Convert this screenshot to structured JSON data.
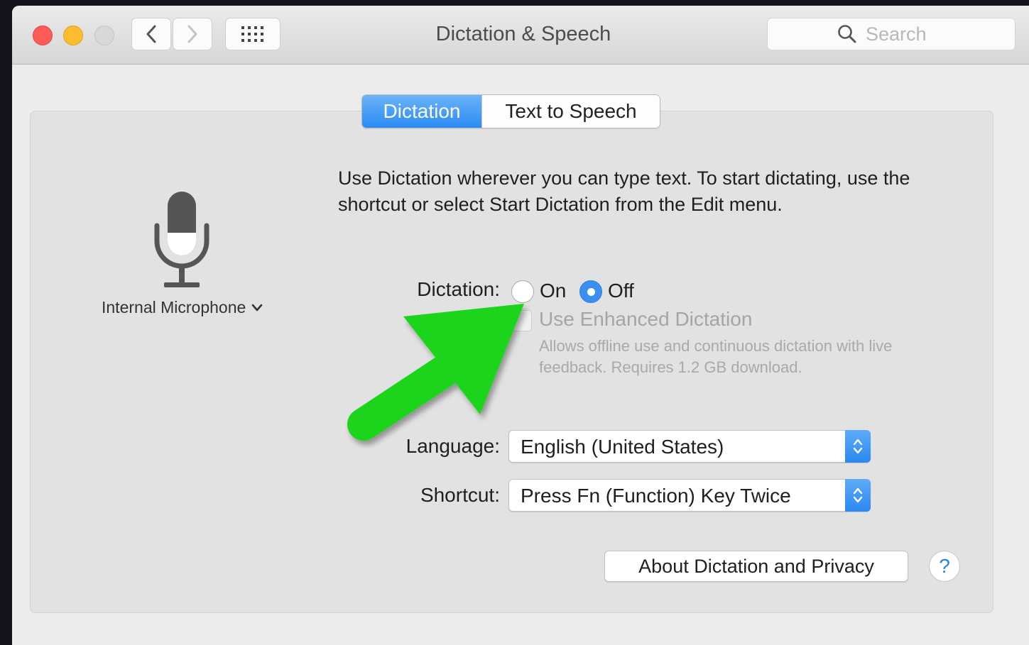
{
  "window": {
    "title": "Dictation & Speech"
  },
  "search": {
    "placeholder": "Search"
  },
  "tabs": [
    {
      "label": "Dictation",
      "selected": true
    },
    {
      "label": "Text to Speech",
      "selected": false
    }
  ],
  "microphone": {
    "label": "Internal Microphone"
  },
  "description": "Use Dictation wherever you can type text. To start dictating, use the shortcut or select Start Dictation from the Edit menu.",
  "dictation": {
    "label": "Dictation:",
    "on_label": "On",
    "off_label": "Off",
    "selected": "Off"
  },
  "enhanced": {
    "label": "Use Enhanced Dictation",
    "checked": false,
    "enabled": false,
    "description": "Allows offline use and continuous dictation with live feedback. Requires 1.2 GB download."
  },
  "language": {
    "label": "Language:",
    "value": "English (United States)"
  },
  "shortcut": {
    "label": "Shortcut:",
    "value": "Press Fn (Function) Key Twice"
  },
  "about_button": "About Dictation and Privacy",
  "help_button": "?",
  "colors": {
    "accent": "#2a8bf2",
    "annotation_arrow": "#1fd41f",
    "close": "#fc5b57",
    "minimize": "#fdbb2e"
  }
}
